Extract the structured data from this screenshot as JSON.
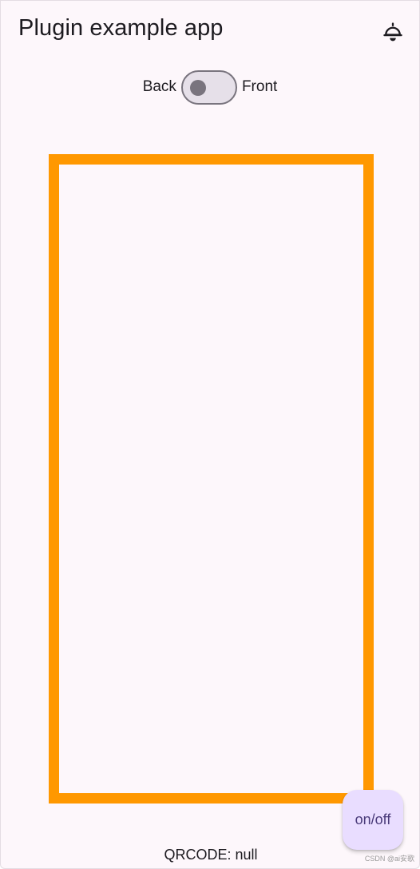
{
  "app_bar": {
    "title": "Plugin example app",
    "flash_icon": "flash-light-icon"
  },
  "camera_toggle": {
    "left_label": "Back",
    "right_label": "Front",
    "state": "off"
  },
  "scan_frame": {
    "color": "#ff9800"
  },
  "result": {
    "text": "QRCODE: null"
  },
  "fab": {
    "label": "on/off"
  },
  "watermark": {
    "text": "CSDN @ai安歌"
  },
  "colors": {
    "background": "#fdf7fb",
    "frame": "#ff9800",
    "fab_bg": "#e9ddff",
    "switch_outline": "#79747e"
  }
}
